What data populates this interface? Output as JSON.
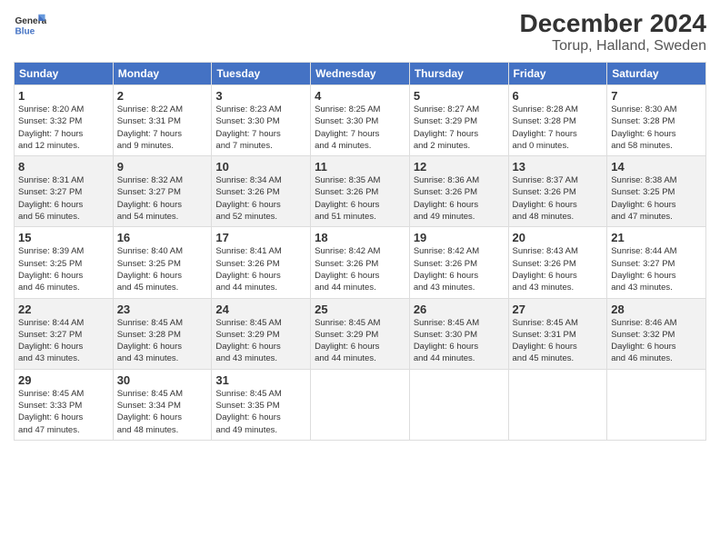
{
  "logo": {
    "line1": "General",
    "line2": "Blue"
  },
  "title": "December 2024",
  "subtitle": "Torup, Halland, Sweden",
  "days_of_week": [
    "Sunday",
    "Monday",
    "Tuesday",
    "Wednesday",
    "Thursday",
    "Friday",
    "Saturday"
  ],
  "weeks": [
    [
      {
        "day": "1",
        "info": "Sunrise: 8:20 AM\nSunset: 3:32 PM\nDaylight: 7 hours\nand 12 minutes."
      },
      {
        "day": "2",
        "info": "Sunrise: 8:22 AM\nSunset: 3:31 PM\nDaylight: 7 hours\nand 9 minutes."
      },
      {
        "day": "3",
        "info": "Sunrise: 8:23 AM\nSunset: 3:30 PM\nDaylight: 7 hours\nand 7 minutes."
      },
      {
        "day": "4",
        "info": "Sunrise: 8:25 AM\nSunset: 3:30 PM\nDaylight: 7 hours\nand 4 minutes."
      },
      {
        "day": "5",
        "info": "Sunrise: 8:27 AM\nSunset: 3:29 PM\nDaylight: 7 hours\nand 2 minutes."
      },
      {
        "day": "6",
        "info": "Sunrise: 8:28 AM\nSunset: 3:28 PM\nDaylight: 7 hours\nand 0 minutes."
      },
      {
        "day": "7",
        "info": "Sunrise: 8:30 AM\nSunset: 3:28 PM\nDaylight: 6 hours\nand 58 minutes."
      }
    ],
    [
      {
        "day": "8",
        "info": "Sunrise: 8:31 AM\nSunset: 3:27 PM\nDaylight: 6 hours\nand 56 minutes."
      },
      {
        "day": "9",
        "info": "Sunrise: 8:32 AM\nSunset: 3:27 PM\nDaylight: 6 hours\nand 54 minutes."
      },
      {
        "day": "10",
        "info": "Sunrise: 8:34 AM\nSunset: 3:26 PM\nDaylight: 6 hours\nand 52 minutes."
      },
      {
        "day": "11",
        "info": "Sunrise: 8:35 AM\nSunset: 3:26 PM\nDaylight: 6 hours\nand 51 minutes."
      },
      {
        "day": "12",
        "info": "Sunrise: 8:36 AM\nSunset: 3:26 PM\nDaylight: 6 hours\nand 49 minutes."
      },
      {
        "day": "13",
        "info": "Sunrise: 8:37 AM\nSunset: 3:26 PM\nDaylight: 6 hours\nand 48 minutes."
      },
      {
        "day": "14",
        "info": "Sunrise: 8:38 AM\nSunset: 3:25 PM\nDaylight: 6 hours\nand 47 minutes."
      }
    ],
    [
      {
        "day": "15",
        "info": "Sunrise: 8:39 AM\nSunset: 3:25 PM\nDaylight: 6 hours\nand 46 minutes."
      },
      {
        "day": "16",
        "info": "Sunrise: 8:40 AM\nSunset: 3:25 PM\nDaylight: 6 hours\nand 45 minutes."
      },
      {
        "day": "17",
        "info": "Sunrise: 8:41 AM\nSunset: 3:26 PM\nDaylight: 6 hours\nand 44 minutes."
      },
      {
        "day": "18",
        "info": "Sunrise: 8:42 AM\nSunset: 3:26 PM\nDaylight: 6 hours\nand 44 minutes."
      },
      {
        "day": "19",
        "info": "Sunrise: 8:42 AM\nSunset: 3:26 PM\nDaylight: 6 hours\nand 43 minutes."
      },
      {
        "day": "20",
        "info": "Sunrise: 8:43 AM\nSunset: 3:26 PM\nDaylight: 6 hours\nand 43 minutes."
      },
      {
        "day": "21",
        "info": "Sunrise: 8:44 AM\nSunset: 3:27 PM\nDaylight: 6 hours\nand 43 minutes."
      }
    ],
    [
      {
        "day": "22",
        "info": "Sunrise: 8:44 AM\nSunset: 3:27 PM\nDaylight: 6 hours\nand 43 minutes."
      },
      {
        "day": "23",
        "info": "Sunrise: 8:45 AM\nSunset: 3:28 PM\nDaylight: 6 hours\nand 43 minutes."
      },
      {
        "day": "24",
        "info": "Sunrise: 8:45 AM\nSunset: 3:29 PM\nDaylight: 6 hours\nand 43 minutes."
      },
      {
        "day": "25",
        "info": "Sunrise: 8:45 AM\nSunset: 3:29 PM\nDaylight: 6 hours\nand 44 minutes."
      },
      {
        "day": "26",
        "info": "Sunrise: 8:45 AM\nSunset: 3:30 PM\nDaylight: 6 hours\nand 44 minutes."
      },
      {
        "day": "27",
        "info": "Sunrise: 8:45 AM\nSunset: 3:31 PM\nDaylight: 6 hours\nand 45 minutes."
      },
      {
        "day": "28",
        "info": "Sunrise: 8:46 AM\nSunset: 3:32 PM\nDaylight: 6 hours\nand 46 minutes."
      }
    ],
    [
      {
        "day": "29",
        "info": "Sunrise: 8:45 AM\nSunset: 3:33 PM\nDaylight: 6 hours\nand 47 minutes."
      },
      {
        "day": "30",
        "info": "Sunrise: 8:45 AM\nSunset: 3:34 PM\nDaylight: 6 hours\nand 48 minutes."
      },
      {
        "day": "31",
        "info": "Sunrise: 8:45 AM\nSunset: 3:35 PM\nDaylight: 6 hours\nand 49 minutes."
      },
      {
        "day": "",
        "info": ""
      },
      {
        "day": "",
        "info": ""
      },
      {
        "day": "",
        "info": ""
      },
      {
        "day": "",
        "info": ""
      }
    ]
  ]
}
